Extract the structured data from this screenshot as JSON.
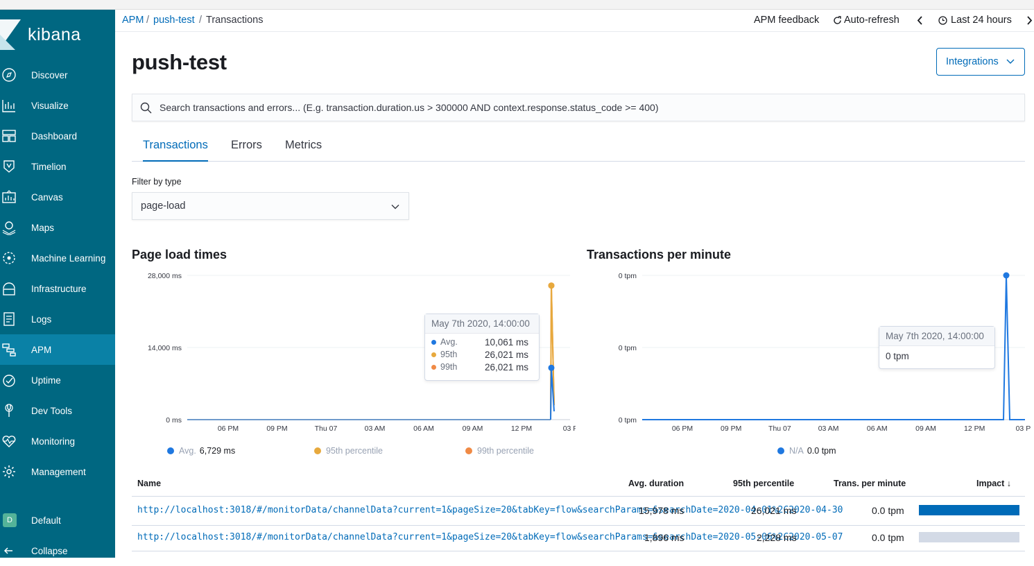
{
  "app": {
    "name": "kibana"
  },
  "sidebar": {
    "items": [
      {
        "label": "Discover"
      },
      {
        "label": "Visualize"
      },
      {
        "label": "Dashboard"
      },
      {
        "label": "Timelion"
      },
      {
        "label": "Canvas"
      },
      {
        "label": "Maps"
      },
      {
        "label": "Machine Learning"
      },
      {
        "label": "Infrastructure"
      },
      {
        "label": "Logs"
      },
      {
        "label": "APM"
      },
      {
        "label": "Uptime"
      },
      {
        "label": "Dev Tools"
      },
      {
        "label": "Monitoring"
      },
      {
        "label": "Management"
      }
    ],
    "active": "APM",
    "space": {
      "badge": "D",
      "label": "Default"
    },
    "collapse_label": "Collapse"
  },
  "breadcrumb": {
    "root": "APM",
    "service": "push-test",
    "current": "Transactions",
    "sep": "/"
  },
  "topbar": {
    "feedback": "APM feedback",
    "auto_refresh": "Auto-refresh",
    "time_range": "Last 24 hours"
  },
  "page": {
    "title": "push-test",
    "integrations_label": "Integrations"
  },
  "search": {
    "placeholder": "Search transactions and errors... (E.g. transaction.duration.us > 300000 AND context.response.status_code >= 400)"
  },
  "tabs": [
    {
      "label": "Transactions"
    },
    {
      "label": "Errors"
    },
    {
      "label": "Metrics"
    }
  ],
  "filter": {
    "label": "Filter by type",
    "value": "page-load"
  },
  "colors": {
    "sidebar": "#006781",
    "accent": "#006bb8",
    "avg": "#1f78e0",
    "p95": "#e7a93d",
    "p99": "#f08a45"
  },
  "chart_data": [
    {
      "type": "line",
      "title": "Page load times",
      "y_ticks": [
        "28,000 ms",
        "14,000 ms",
        "0 ms"
      ],
      "x_ticks": [
        "06 PM",
        "09 PM",
        "Thu 07",
        "03 AM",
        "06 AM",
        "09 AM",
        "12 PM",
        "03 P"
      ],
      "ylim": [
        0,
        28000
      ],
      "series": [
        {
          "name": "Avg.",
          "color": "#1f78e0",
          "points": [
            {
              "x": "May 7th 2020, 14:00:00",
              "y": 10061
            },
            {
              "x": "end",
              "y": 1600
            }
          ]
        },
        {
          "name": "95th percentile",
          "color": "#e7a93d",
          "points": [
            {
              "x": "May 7th 2020, 14:00:00",
              "y": 26021
            },
            {
              "x": "end",
              "y": 2800
            }
          ]
        },
        {
          "name": "99th percentile",
          "color": "#f08a45",
          "points": [
            {
              "x": "May 7th 2020, 14:00:00",
              "y": 26021
            },
            {
              "x": "end",
              "y": 2800
            }
          ]
        }
      ],
      "tooltip": {
        "title": "May 7th 2020, 14:00:00",
        "rows": [
          {
            "name": "Avg.",
            "value": "10,061 ms"
          },
          {
            "name": "95th",
            "value": "26,021 ms"
          },
          {
            "name": "99th",
            "value": "26,021 ms"
          }
        ]
      },
      "legend": [
        {
          "name": "Avg.",
          "value": "6,729 ms"
        },
        {
          "name": "95th percentile",
          "value": ""
        },
        {
          "name": "99th percentile",
          "value": ""
        }
      ]
    },
    {
      "type": "line",
      "title": "Transactions per minute",
      "y_ticks": [
        "0 tpm",
        "0 tpm",
        "0 tpm"
      ],
      "x_ticks": [
        "06 PM",
        "09 PM",
        "Thu 07",
        "03 AM",
        "06 AM",
        "09 AM",
        "12 PM",
        "03 P"
      ],
      "ylim": [
        0,
        1
      ],
      "series": [
        {
          "name": "N/A",
          "color": "#1f78e0",
          "peak_x": "May 7th 2020, 14:00:00",
          "peak_y": 1
        }
      ],
      "tooltip": {
        "title": "May 7th 2020, 14:00:00",
        "value": "0 tpm"
      },
      "legend": [
        {
          "name": "N/A",
          "value": "0.0 tpm"
        }
      ]
    }
  ],
  "table": {
    "columns": [
      "Name",
      "Avg. duration",
      "95th percentile",
      "Trans. per minute",
      "Impact"
    ],
    "sort_indicator": "↓",
    "rows": [
      {
        "name": "http://localhost:3018/#/monitorData/channelData?current=1&pageSize=20&tabKey=flow&searchParams=&searchDate=2020-04-01%2C2020-04-30",
        "name_visible": "http://localhost:3018/#/monitorData/channelData?current=1&pageSize=20&tabKey=flow&searchParams=&searchDate=2020-04-01%2C2020-04-30",
        "avg": "15,978 ms",
        "p95": "26,021 ms",
        "tpm": "0.0 tpm",
        "impact": 1.0
      },
      {
        "name": "http://localhost:3018/#/monitorData/channelData?current=1&pageSize=20&tabKey=flow&searchParams=&searchDate=2020-05-06%2C2020-05-07",
        "name_visible": "http://localhost:3018/#/monitorData/channelData?current=1&pageSize=20&tabKey=flow&searchParams=&searchDate=2020-05-06%2C2020-05-07",
        "avg": "1,896 ms",
        "p95": "2,228 ms",
        "tpm": "0.0 tpm",
        "impact": 0.0
      }
    ]
  }
}
